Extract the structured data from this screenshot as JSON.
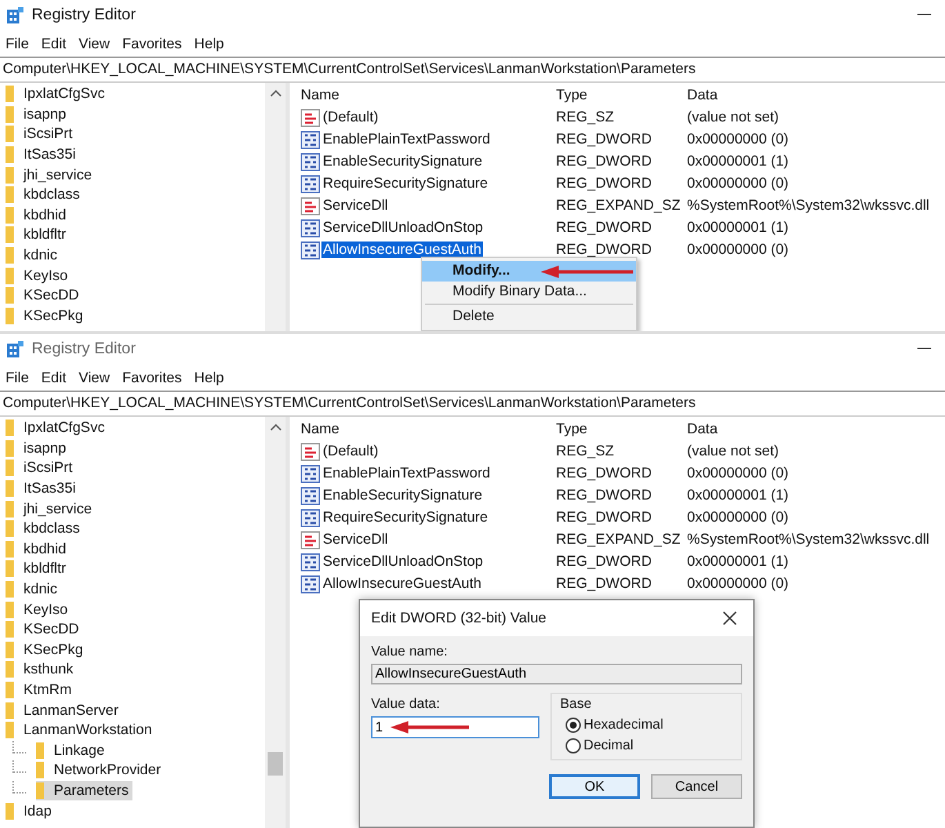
{
  "panels": [
    {
      "title": "Registry Editor",
      "menu": [
        "File",
        "Edit",
        "View",
        "Favorites",
        "Help"
      ],
      "address": "Computer\\HKEY_LOCAL_MACHINE\\SYSTEM\\CurrentControlSet\\Services\\LanmanWorkstation\\Parameters",
      "tree": [
        {
          "label": "IpxlatCfgSvc",
          "selected": false
        },
        {
          "label": "isapnp",
          "selected": false
        },
        {
          "label": "iScsiPrt",
          "selected": false
        },
        {
          "label": "ItSas35i",
          "selected": false
        },
        {
          "label": "jhi_service",
          "selected": false
        },
        {
          "label": "kbdclass",
          "selected": false
        },
        {
          "label": "kbdhid",
          "selected": false
        },
        {
          "label": "kbldfltr",
          "selected": false
        },
        {
          "label": "kdnic",
          "selected": false
        },
        {
          "label": "KeyIso",
          "selected": false
        },
        {
          "label": "KSecDD",
          "selected": false
        },
        {
          "label": "KSecPkg",
          "selected": false
        }
      ],
      "columns": [
        "Name",
        "Type",
        "Data"
      ],
      "values": [
        {
          "kind": "string",
          "name": "(Default)",
          "type": "REG_SZ",
          "data": "(value not set)",
          "selected": false
        },
        {
          "kind": "dword",
          "name": "EnablePlainTextPassword",
          "type": "REG_DWORD",
          "data": "0x00000000 (0)",
          "selected": false
        },
        {
          "kind": "dword",
          "name": "EnableSecuritySignature",
          "type": "REG_DWORD",
          "data": "0x00000001 (1)",
          "selected": false
        },
        {
          "kind": "dword",
          "name": "RequireSecuritySignature",
          "type": "REG_DWORD",
          "data": "0x00000000 (0)",
          "selected": false
        },
        {
          "kind": "string",
          "name": "ServiceDll",
          "type": "REG_EXPAND_SZ",
          "data": "%SystemRoot%\\System32\\wkssvc.dll",
          "selected": false
        },
        {
          "kind": "dword",
          "name": "ServiceDllUnloadOnStop",
          "type": "REG_DWORD",
          "data": "0x00000001 (1)",
          "selected": false
        },
        {
          "kind": "dword",
          "name": "AllowInsecureGuestAuth",
          "type": "REG_DWORD",
          "data": "0x00000000 (0)",
          "selected": true
        }
      ],
      "context_menu": [
        {
          "label": "Modify...",
          "selected": true
        },
        {
          "label": "Modify Binary Data...",
          "selected": false
        },
        {
          "label": "Delete",
          "selected": false
        }
      ]
    },
    {
      "title": "Registry Editor",
      "menu": [
        "File",
        "Edit",
        "View",
        "Favorites",
        "Help"
      ],
      "address": "Computer\\HKEY_LOCAL_MACHINE\\SYSTEM\\CurrentControlSet\\Services\\LanmanWorkstation\\Parameters",
      "tree": [
        {
          "label": "IpxlatCfgSvc",
          "selected": false
        },
        {
          "label": "isapnp",
          "selected": false
        },
        {
          "label": "iScsiPrt",
          "selected": false
        },
        {
          "label": "ItSas35i",
          "selected": false
        },
        {
          "label": "jhi_service",
          "selected": false
        },
        {
          "label": "kbdclass",
          "selected": false
        },
        {
          "label": "kbdhid",
          "selected": false
        },
        {
          "label": "kbldfltr",
          "selected": false
        },
        {
          "label": "kdnic",
          "selected": false
        },
        {
          "label": "KeyIso",
          "selected": false
        },
        {
          "label": "KSecDD",
          "selected": false
        },
        {
          "label": "KSecPkg",
          "selected": false
        },
        {
          "label": "ksthunk",
          "selected": false
        },
        {
          "label": "KtmRm",
          "selected": false
        },
        {
          "label": "LanmanServer",
          "selected": false
        },
        {
          "label": "LanmanWorkstation",
          "selected": false,
          "children": [
            {
              "label": "Linkage",
              "selected": false
            },
            {
              "label": "NetworkProvider",
              "selected": false
            },
            {
              "label": "Parameters",
              "selected": true
            }
          ]
        },
        {
          "label": "Idap",
          "selected": false
        }
      ],
      "columns": [
        "Name",
        "Type",
        "Data"
      ],
      "values": [
        {
          "kind": "string",
          "name": "(Default)",
          "type": "REG_SZ",
          "data": "(value not set)",
          "selected": false
        },
        {
          "kind": "dword",
          "name": "EnablePlainTextPassword",
          "type": "REG_DWORD",
          "data": "0x00000000 (0)",
          "selected": false
        },
        {
          "kind": "dword",
          "name": "EnableSecuritySignature",
          "type": "REG_DWORD",
          "data": "0x00000001 (1)",
          "selected": false
        },
        {
          "kind": "dword",
          "name": "RequireSecuritySignature",
          "type": "REG_DWORD",
          "data": "0x00000000 (0)",
          "selected": false
        },
        {
          "kind": "string",
          "name": "ServiceDll",
          "type": "REG_EXPAND_SZ",
          "data": "%SystemRoot%\\System32\\wkssvc.dll",
          "selected": false
        },
        {
          "kind": "dword",
          "name": "ServiceDllUnloadOnStop",
          "type": "REG_DWORD",
          "data": "0x00000001 (1)",
          "selected": false
        },
        {
          "kind": "dword",
          "name": "AllowInsecureGuestAuth",
          "type": "REG_DWORD",
          "data": "0x00000000 (0)",
          "selected": false
        }
      ],
      "dialog": {
        "title": "Edit DWORD (32-bit) Value",
        "value_name_label": "Value name:",
        "value_name": "AllowInsecureGuestAuth",
        "value_data_label": "Value data:",
        "value_data": "1",
        "base_label": "Base",
        "base_options": [
          {
            "label": "Hexadecimal",
            "selected": true
          },
          {
            "label": "Decimal",
            "selected": false
          }
        ],
        "buttons": [
          {
            "label": "OK",
            "kind": "default"
          },
          {
            "label": "Cancel",
            "kind": "normal"
          }
        ]
      }
    }
  ]
}
